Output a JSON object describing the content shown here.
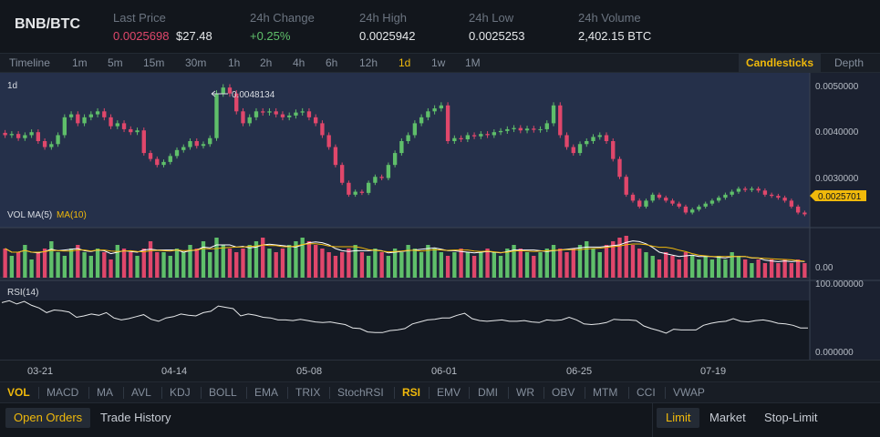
{
  "header": {
    "pair": "BNB/BTC",
    "last_price_label": "Last Price",
    "last_price": "0.0025698",
    "last_price_usd": "$27.48",
    "change_label": "24h Change",
    "change": "+0.25%",
    "high_label": "24h High",
    "high": "0.0025942",
    "low_label": "24h Low",
    "low": "0.0025253",
    "volume_label": "24h Volume",
    "volume": "2,402.15 BTC"
  },
  "intervals": [
    "Timeline",
    "1m",
    "5m",
    "15m",
    "30m",
    "1h",
    "2h",
    "4h",
    "6h",
    "12h",
    "1d",
    "1w",
    "1M"
  ],
  "active_interval": "1d",
  "views": {
    "candles": "Candlesticks",
    "depth": "Depth"
  },
  "chart": {
    "interval_label": "1d",
    "max_label": "0.0048134",
    "price_ticks": [
      "0.0050000",
      "0.0040000",
      "0.0030000"
    ],
    "current_price": "0.0025701",
    "vol_label": "VOL",
    "ma5_label": "MA(5)",
    "ma10_label": "MA(10)",
    "vol_tick": "0.00",
    "rsi_label": "RSI(14)",
    "rsi_ticks": [
      "100.000000",
      "0.000000"
    ],
    "dates": [
      "03-21",
      "04-14",
      "05-08",
      "06-01",
      "06-25",
      "07-19"
    ]
  },
  "colors": {
    "up": "#5fbf6a",
    "down": "#e0476b",
    "accent": "#f0b90b",
    "ma5": "#ffffff",
    "ma10": "#f0b90b"
  },
  "indicators": [
    "VOL",
    "MACD",
    "MA",
    "AVL",
    "KDJ",
    "BOLL",
    "EMA",
    "TRIX",
    "StochRSI",
    "RSI",
    "EMV",
    "DMI",
    "WR",
    "OBV",
    "MTM",
    "CCI",
    "VWAP"
  ],
  "active_indicators": [
    "VOL",
    "RSI"
  ],
  "bottom": {
    "open_orders": "Open Orders",
    "trade_history": "Trade History",
    "order_types": [
      "Limit",
      "Market",
      "Stop-Limit"
    ]
  },
  "chart_data": {
    "type": "candlestick",
    "y_range": [
      0.0025,
      0.0051
    ],
    "close": [
      0.0039,
      0.00392,
      0.00385,
      0.0039,
      0.00395,
      0.0038,
      0.0037,
      0.00375,
      0.0039,
      0.0042,
      0.00425,
      0.0041,
      0.0042,
      0.00425,
      0.0043,
      0.0042,
      0.00405,
      0.0041,
      0.004,
      0.00395,
      0.00398,
      0.0036,
      0.0035,
      0.0034,
      0.00345,
      0.00355,
      0.00365,
      0.0037,
      0.0038,
      0.00372,
      0.00375,
      0.00385,
      0.0046,
      0.0047,
      0.0046,
      0.0043,
      0.0041,
      0.0042,
      0.0043,
      0.00428,
      0.0043,
      0.00425,
      0.0042,
      0.00423,
      0.00428,
      0.0043,
      0.0042,
      0.0041,
      0.0039,
      0.0037,
      0.0034,
      0.0031,
      0.0029,
      0.00295,
      0.00293,
      0.0031,
      0.0032,
      0.00318,
      0.0034,
      0.0036,
      0.0038,
      0.0039,
      0.0041,
      0.0042,
      0.0043,
      0.00435,
      0.0044,
      0.0038,
      0.00385,
      0.00383,
      0.0039,
      0.00388,
      0.00392,
      0.0039,
      0.00395,
      0.00397,
      0.004,
      0.00402,
      0.00398,
      0.00401,
      0.00399,
      0.004,
      0.0041,
      0.0044,
      0.0039,
      0.0037,
      0.0036,
      0.00375,
      0.0038,
      0.00387,
      0.0039,
      0.0038,
      0.0035,
      0.0032,
      0.0029,
      0.0028,
      0.0027,
      0.0028,
      0.0029,
      0.00285,
      0.0028,
      0.00275,
      0.0027,
      0.0026,
      0.00265,
      0.0027,
      0.00275,
      0.0028,
      0.00285,
      0.0029,
      0.00295,
      0.003,
      0.00298,
      0.003,
      0.00297,
      0.0029,
      0.00288,
      0.00285,
      0.0028,
      0.0027,
      0.0026,
      0.00257
    ],
    "rsi": [
      72,
      75,
      70,
      74,
      68,
      64,
      57,
      61,
      60,
      58,
      50,
      52,
      55,
      53,
      57,
      49,
      46,
      48,
      51,
      54,
      47,
      44,
      49,
      51,
      55,
      53,
      52,
      57,
      59,
      67,
      65,
      63,
      52,
      55,
      53,
      50,
      49,
      46,
      46,
      45,
      47,
      45,
      43,
      42,
      43,
      41,
      39,
      34,
      33,
      28,
      27,
      27,
      30,
      31,
      33,
      40,
      43,
      46,
      47,
      49,
      49,
      53,
      56,
      48,
      45,
      44,
      45,
      46,
      44,
      44,
      45,
      43,
      42,
      46,
      45,
      46,
      50,
      46,
      40,
      39,
      40,
      42,
      47,
      46,
      46,
      45,
      37,
      33,
      30,
      26,
      32,
      31,
      31,
      31,
      38,
      41,
      43,
      44,
      48,
      44,
      43,
      45,
      46,
      44,
      41,
      40,
      38,
      34,
      34
    ],
    "volume_scale": [
      0.6,
      0.4,
      0.5,
      0.7,
      0.3,
      0.5,
      0.6,
      0.8,
      0.5,
      0.4,
      0.6,
      0.7,
      0.5,
      0.4,
      0.6,
      0.5,
      0.3,
      0.7,
      0.6,
      0.5,
      0.4,
      0.6,
      0.8,
      0.5,
      0.5,
      0.4,
      0.6,
      0.5,
      0.7,
      0.6,
      0.8,
      0.5,
      0.9,
      0.7,
      0.6,
      0.5,
      0.6,
      0.7,
      0.8,
      0.9,
      0.6,
      0.5,
      0.6,
      0.7,
      0.8,
      0.9,
      0.8,
      0.7,
      0.6,
      0.5,
      0.4,
      0.5,
      0.6,
      0.7,
      0.5,
      0.4,
      0.6,
      0.5,
      0.4,
      0.6,
      0.5,
      0.7,
      0.6,
      0.5,
      0.7,
      0.6,
      0.5,
      0.4,
      0.5,
      0.6,
      0.5,
      0.4,
      0.5,
      0.6,
      0.5,
      0.4,
      0.6,
      0.7,
      0.6,
      0.5,
      0.4,
      0.5,
      0.6,
      0.7,
      0.6,
      0.5,
      0.6,
      0.7,
      0.8,
      0.6,
      0.5,
      0.7,
      0.8,
      0.9,
      0.95,
      0.7,
      0.6,
      0.5,
      0.4,
      0.3,
      0.5,
      0.4,
      0.3,
      0.5,
      0.4,
      0.3,
      0.4,
      0.3,
      0.4,
      0.3,
      0.5,
      0.4,
      0.3,
      0.2,
      0.3,
      0.2,
      0.3,
      0.2,
      0.3,
      0.2,
      0.3,
      0.2
    ]
  }
}
